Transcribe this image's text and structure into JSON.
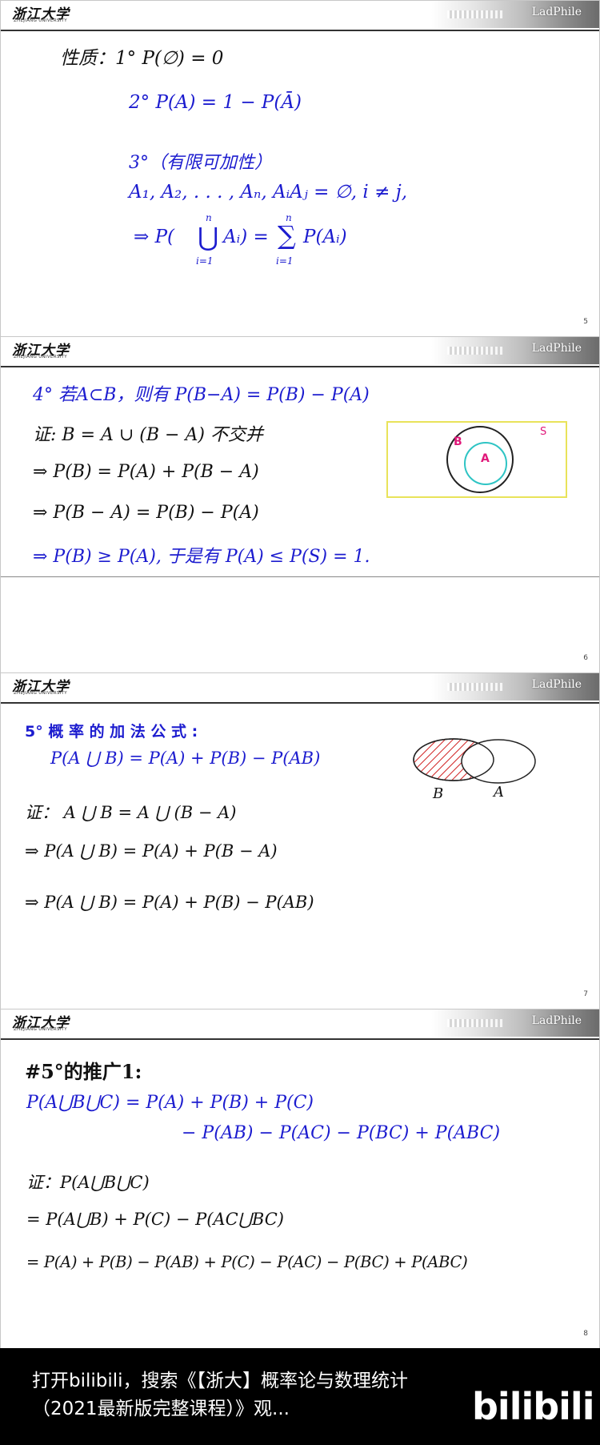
{
  "header": {
    "logo_cn": "浙江大学",
    "logo_en": "ZHEJIANG UNIVERSITY",
    "brand": "LadPhile"
  },
  "slide5": {
    "page": "5",
    "p1": "性质：1° P(∅) = 0",
    "p2": "2° P(A) = 1 − P(Ā)",
    "p3": "3°（有限可加性）",
    "p3_cond": "A₁, A₂, . . . , Aₙ, AᵢAⱼ = ∅, i ≠ j,",
    "p3_implies": "⇒ P(",
    "p3_union": "⋃",
    "p3_union_top": "n",
    "p3_union_bottom": "i=1",
    "p3_mid": "Aᵢ) =",
    "p3_sum": "∑",
    "p3_sum_top": "n",
    "p3_sum_bottom": "i=1",
    "p3_end": "P(Aᵢ)"
  },
  "slide6": {
    "page": "6",
    "p4": "4°  若A⊂B，则有  P(B−A) = P(B) − P(A)",
    "proof": "证: B = A ∪ (B − A)  不交并",
    "l1": "⇒ P(B) = P(A) + P(B − A)",
    "l2": "⇒ P(B − A) = P(B) − P(A)",
    "l3": "⇒ P(B) ≥ P(A), 于是有   P(A) ≤ P(S) = 1.",
    "venn": {
      "label_s": "S",
      "label_b": "B",
      "label_a": "A"
    }
  },
  "slide7": {
    "page": "7",
    "p5": "5° 概 率 的 加 法 公 式 :",
    "formula": "P(A ⋃ B) = P(A) + P(B) − P(AB)",
    "proof": "证： A ⋃ B = A ⋃ (B − A)",
    "l1": "⇒ P(A ⋃ B) = P(A) + P(B − A)",
    "l2": "⇒ P(A ⋃ B) = P(A) + P(B) − P(AB)",
    "venn": {
      "label_b": "B",
      "label_a": "A"
    }
  },
  "slide8": {
    "page": "8",
    "title": "#5°的推广1:",
    "f1": "P(A⋃B⋃C) = P(A) + P(B) + P(C)",
    "f2": "− P(AB) − P(AC) − P(BC) + P(ABC)",
    "proof": "证：P(A⋃B⋃C)",
    "l1": "= P(A⋃B) + P(C) − P(AC⋃BC)",
    "l2": "= P(A) + P(B) − P(AB) + P(C) − P(AC) − P(BC) + P(ABC)"
  },
  "footer": {
    "text": "打开bilibili，搜索《【浙大】概率论与数理统计（2021最新版完整课程）》观...",
    "logo": "bilibili"
  },
  "colors": {
    "formula_blue": "#1c1ccf",
    "venn_frame": "#e9e35a",
    "venn_b_label": "#e0187a",
    "venn_a_circle": "#2ec4c4",
    "hatch": "#d02020"
  }
}
